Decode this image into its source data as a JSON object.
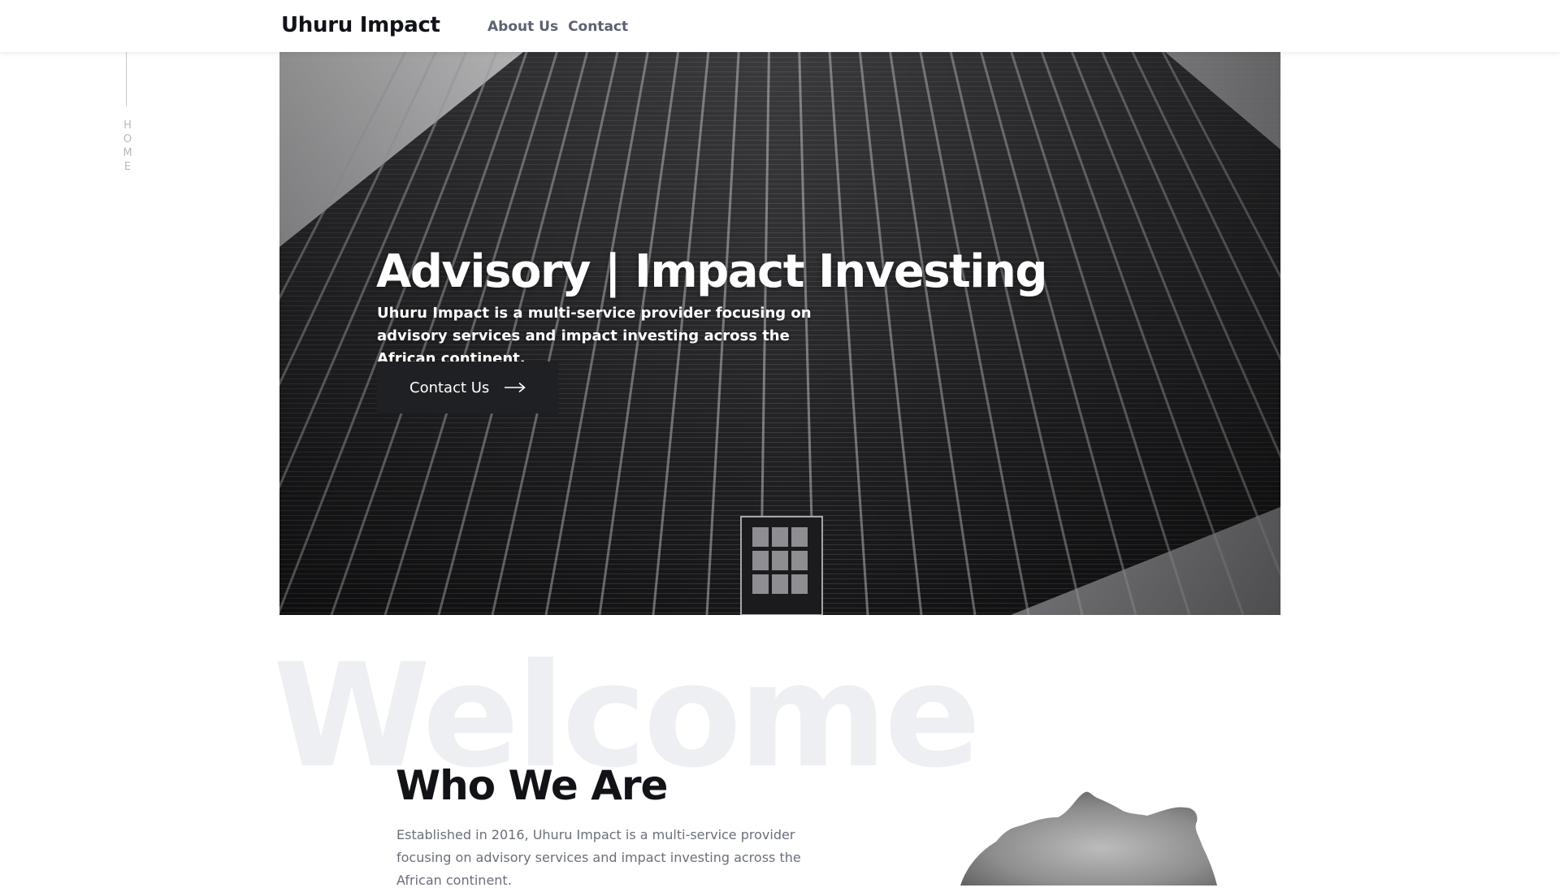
{
  "header": {
    "logo": "Uhuru Impact",
    "nav": [
      {
        "label": "About Us"
      },
      {
        "label": "Contact"
      }
    ]
  },
  "side_indicator": {
    "letters": [
      "H",
      "O",
      "M",
      "E"
    ]
  },
  "hero": {
    "title": "Advisory | Impact Investing",
    "subtitle": "Uhuru Impact is a multi-service provider focusing on advisory services and impact investing across the African continent.",
    "button": {
      "label": "Contact Us",
      "icon": "arrow-right-icon"
    },
    "background": "building-facade-image"
  },
  "welcome": {
    "watermark": "Welcome",
    "title": "Who We Are",
    "text": "Established in 2016, Uhuru Impact is a multi-service provider focusing on advisory services and impact investing across the African continent.",
    "image": "africa-map-image"
  },
  "colors": {
    "text_dark": "#121317",
    "nav_gray": "#5d6270",
    "button_bg": "#1f2024",
    "watermark": "#eeeff3",
    "body_text": "#6a6f7b"
  }
}
